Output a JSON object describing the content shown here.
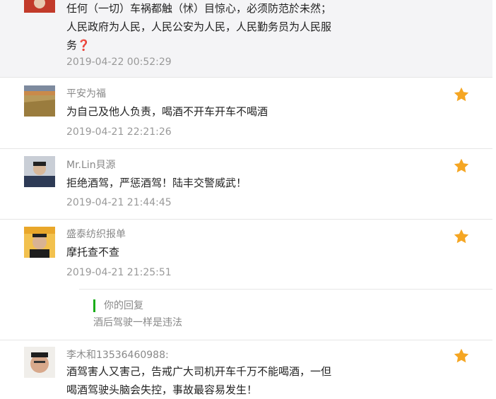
{
  "comments": [
    {
      "name": "",
      "lines": [
        "任何（一切）车祸都触（怵）目惊心，必须防范於未然；",
        "人民政府为人民，人民公安为人民，人民勤务员为人民服",
        "务"
      ],
      "emoji": "❓",
      "time": "2019-04-22 00:52:29",
      "starred": false
    },
    {
      "name": "平安为福",
      "text": "为自己及他人负责，喝酒不开车开车不喝酒",
      "time": "2019-04-21 22:21:26",
      "starred": true
    },
    {
      "name": "Mr.Lin貝源",
      "text": "拒绝酒驾，严惩酒驾！陆丰交警威武！",
      "time": "2019-04-21 21:44:45",
      "starred": true
    },
    {
      "name": "盛泰纺织报单",
      "text": "摩托查不查",
      "time": "2019-04-21 21:25:51",
      "starred": true,
      "reply": {
        "label": "你的回复",
        "text": "酒后驾驶一样是违法"
      }
    },
    {
      "name": "李木和13536460988:",
      "lines": [
        "酒驾害人又害己，告戒广大司机开车千万不能喝酒，一但",
        "喝酒驾驶头脑会失控，事故最容易发生！"
      ],
      "starred": true
    }
  ],
  "colors": {
    "star": "#f5a623",
    "reply_bar": "#1aad19"
  },
  "icons": {
    "star": "star-icon",
    "question": "question-mark-emoji"
  }
}
